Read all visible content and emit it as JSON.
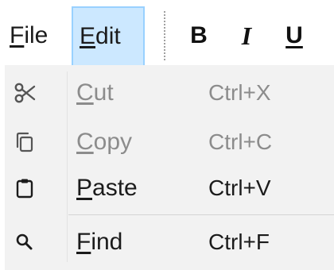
{
  "menubar": {
    "file": {
      "mnemonic": "F",
      "rest": "ile"
    },
    "edit": {
      "mnemonic": "E",
      "rest": "dit"
    }
  },
  "toolbar": {
    "bold_label": "B",
    "italic_label": "I",
    "underline_label": "U"
  },
  "edit_menu": {
    "items": [
      {
        "mnemonic": "C",
        "rest": "ut",
        "shortcut": "Ctrl+X",
        "icon": "scissors-icon",
        "enabled": false
      },
      {
        "mnemonic": "C",
        "rest": "opy",
        "shortcut": "Ctrl+C",
        "icon": "copy-icon",
        "enabled": false
      },
      {
        "mnemonic": "P",
        "rest": "aste",
        "shortcut": "Ctrl+V",
        "icon": "clipboard-icon",
        "enabled": true
      },
      {
        "mnemonic": "F",
        "rest": "ind",
        "shortcut": "Ctrl+F",
        "icon": "search-icon",
        "enabled": true
      }
    ]
  },
  "colors": {
    "active_menu_bg": "#cce8ff",
    "active_menu_border": "#99d1ff",
    "dropdown_bg": "#f2f2f2",
    "disabled_text": "#8c8c8c",
    "enabled_text": "#1b1b1b"
  }
}
